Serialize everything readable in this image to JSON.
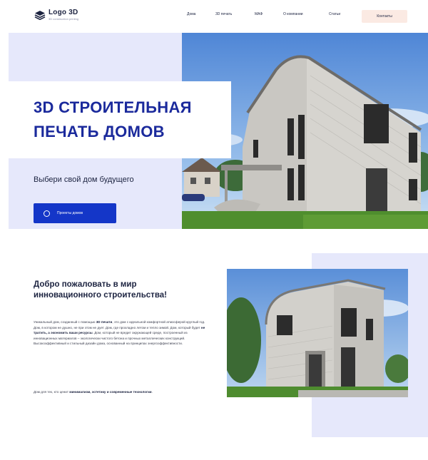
{
  "header": {
    "logo_name": "Logo 3D",
    "logo_sub": "3D construction printing",
    "nav": [
      "Дома",
      "3D печать",
      "МАФ",
      "О компании",
      "Статьи"
    ],
    "contact": "Контакты"
  },
  "hero": {
    "title_line1": "3D СТРОИТЕЛЬНАЯ",
    "title_line2": "ПЕЧАТЬ ДОМОВ",
    "subtitle": "Выбери свой дом будущего",
    "button": "Проекты домов"
  },
  "about": {
    "title_line1": "Добро пожаловать в мир",
    "title_line2": "инновационного строительства!",
    "p1_a": "Уникальный дом, созданный с помощью ",
    "p1_b": "3D печати",
    "p1_c": ", это дом с идеальной комфортной атмосферой круглый год. Дом, в котором не душно, не при этом не дует. Дом, где прохладно летом и тепло зимой. Дом, который будет ",
    "p1_d": "не тратить, а экономить ваши ресурсы",
    "p1_e": ". Дом, который не вредит окружающей среде, построенный из инновационных материалов – экологически чистого бетона и прочных металлических конструкций. Высокоэффективный и стильный дизайн дома, основанный на принципах энергоэффективности.",
    "p2_a": "Дом для тех, кто ценит ",
    "p2_b": "минимализм, эстетику и современные технологии",
    "p2_c": "."
  }
}
